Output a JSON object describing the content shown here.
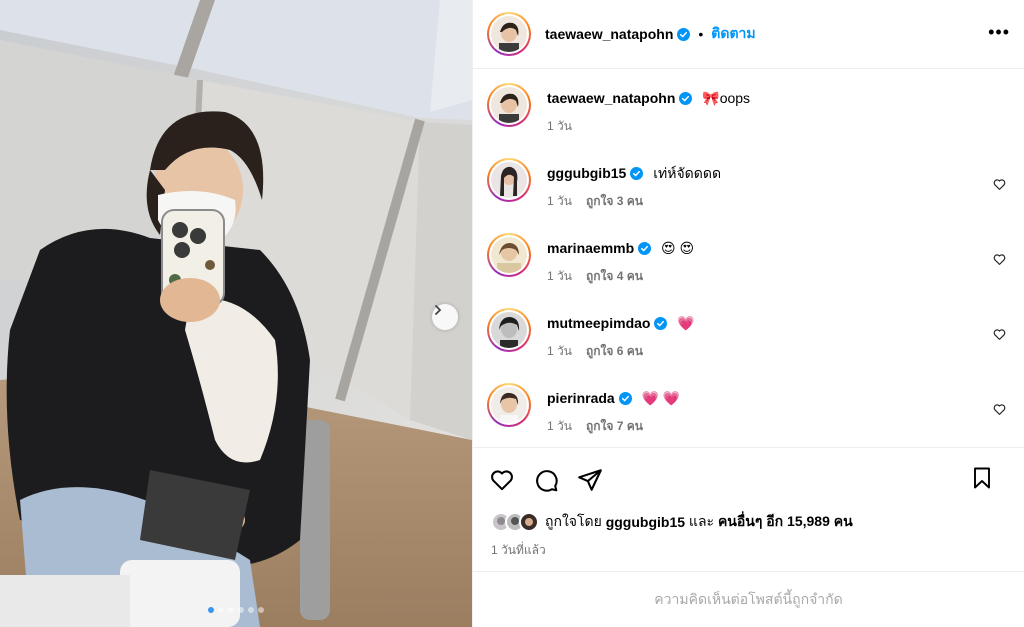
{
  "post": {
    "author": {
      "username": "taewaew_natapohn",
      "follow_label": "ติดตาม",
      "dot": "•"
    },
    "caption": {
      "emoji": "🎀",
      "text": "oops",
      "time": "1 วัน"
    },
    "comments": [
      {
        "username": "gggubgib15",
        "text": "เท่ห์จัดดดด",
        "time": "1 วัน",
        "likes": "ถูกใจ 3 คน"
      },
      {
        "username": "marinaemmb",
        "text": "😍 😍",
        "time": "1 วัน",
        "likes": "ถูกใจ 4 คน"
      },
      {
        "username": "mutmeepimdao",
        "text": "💗",
        "time": "1 วัน",
        "likes": "ถูกใจ 6 คน"
      },
      {
        "username": "pierinrada",
        "text": "💗 💗",
        "time": "1 วัน",
        "likes": "ถูกใจ 7 คน"
      }
    ],
    "liked_by": {
      "prefix": "ถูกใจโดย",
      "user": "gggubgib15",
      "and": "และ",
      "others": "คนอื่นๆ อีก 15,989 คน"
    },
    "time_ago": "1 วันที่แล้ว",
    "comments_limited": "ความคิดเห็นต่อโพสต์นี้ถูกจำกัด"
  },
  "carousel": {
    "slide_count": 6,
    "active_index": 0
  },
  "icons": {
    "like": "heart-icon",
    "comment": "comment-icon",
    "share": "share-icon",
    "save": "bookmark-icon",
    "more": "more-icon",
    "next": "chevron-right-icon",
    "verified": "verified-badge-icon"
  },
  "colors": {
    "accent": "#0095f6",
    "verified": "#0095f6",
    "muted": "#737373"
  }
}
